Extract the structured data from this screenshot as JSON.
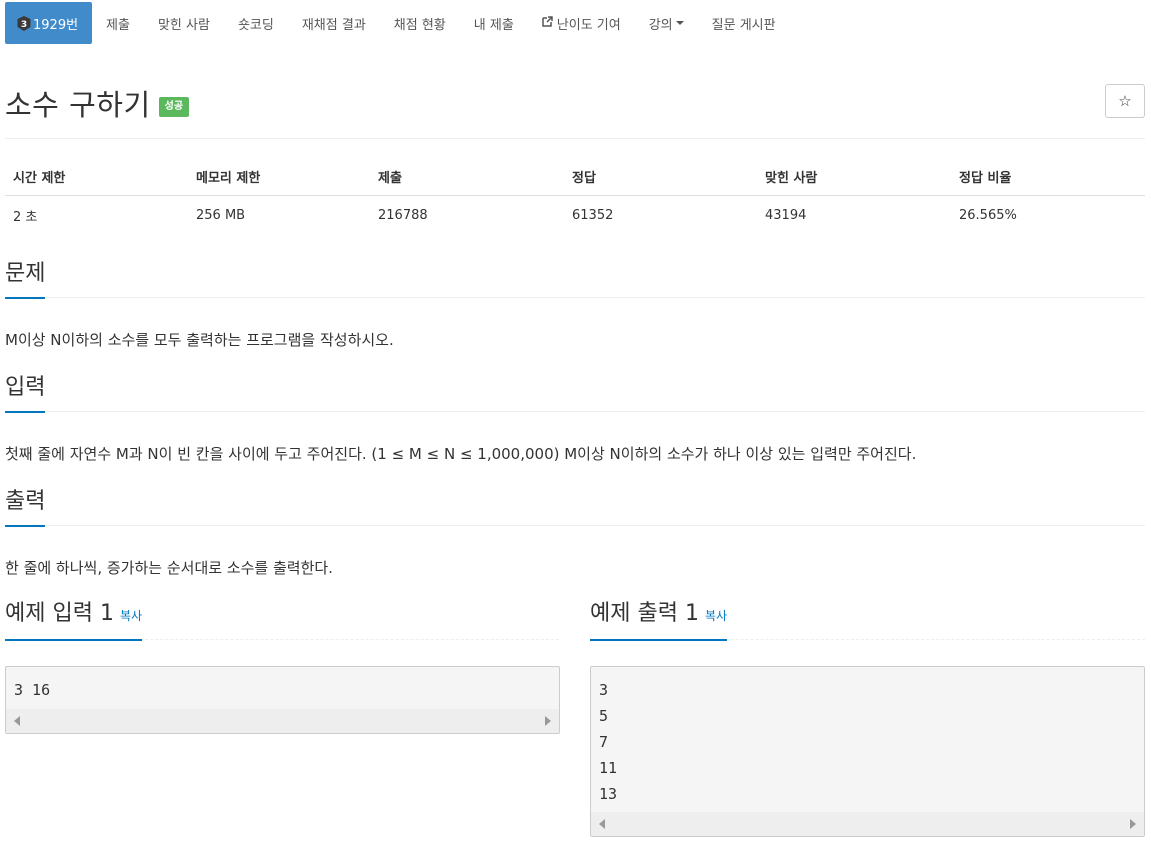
{
  "nav": {
    "tabs": [
      {
        "label": "1929번",
        "tier": "3"
      },
      {
        "label": "제출"
      },
      {
        "label": "맞힌 사람"
      },
      {
        "label": "숏코딩"
      },
      {
        "label": "재채점 결과"
      },
      {
        "label": "채점 현황"
      },
      {
        "label": "내 제출"
      },
      {
        "label": "난이도 기여"
      },
      {
        "label": "강의"
      },
      {
        "label": "질문 게시판"
      }
    ]
  },
  "problem": {
    "title": "소수 구하기",
    "status_badge": "성공",
    "star_glyph": "☆"
  },
  "info": {
    "headers": [
      "시간 제한",
      "메모리 제한",
      "제출",
      "정답",
      "맞힌 사람",
      "정답 비율"
    ],
    "values": [
      "2 초",
      "256 MB",
      "216788",
      "61352",
      "43194",
      "26.565%"
    ]
  },
  "sections": {
    "description": {
      "title": "문제",
      "text": "M이상 N이하의 소수를 모두 출력하는 프로그램을 작성하시오."
    },
    "input": {
      "title": "입력",
      "text": "첫째 줄에 자연수 M과 N이 빈 칸을 사이에 두고 주어진다. (1 ≤ M ≤ N ≤ 1,000,000) M이상 N이하의 소수가 하나 이상 있는 입력만 주어진다."
    },
    "output": {
      "title": "출력",
      "text": "한 줄에 하나씩, 증가하는 순서대로 소수를 출력한다."
    }
  },
  "samples": {
    "input": {
      "title": "예제 입력 1",
      "copy": "복사",
      "content": "3 16"
    },
    "output": {
      "title": "예제 출력 1",
      "copy": "복사",
      "content": "3\n5\n7\n11\n13"
    }
  },
  "colors": {
    "accent": "#428bca",
    "success": "#5cb85c",
    "underline": "#0076c0"
  }
}
